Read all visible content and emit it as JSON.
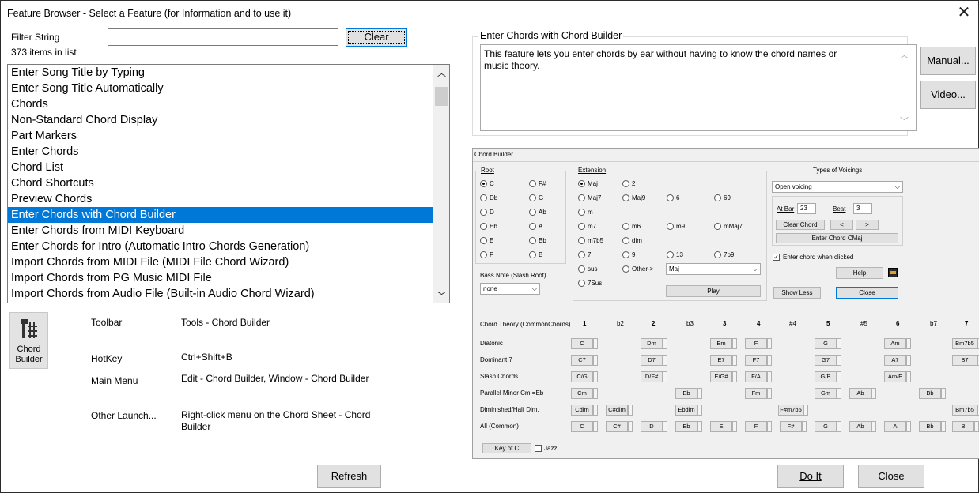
{
  "window": {
    "title": "Feature Browser - Select a Feature (for Information and to use it)"
  },
  "filter": {
    "label": "Filter String",
    "value": "",
    "count_text": "373 items in list",
    "clear_label": "Clear"
  },
  "feature_list": {
    "items": [
      "Enter Song Title by Typing",
      "Enter Song Title Automatically",
      "Chords",
      "Non-Standard Chord Display",
      "Part Markers",
      "Enter Chords",
      "Chord List",
      "Chord Shortcuts",
      "Preview Chords",
      "Enter Chords with Chord Builder",
      "Enter Chords from MIDI Keyboard",
      "Enter Chords for Intro (Automatic Intro Chords Generation)",
      "Import Chords from MIDI File (MIDI File Chord Wizard)",
      "Import Chords from PG Music MIDI File",
      "Import Chords from Audio File (Built-in Audio Chord Wizard)"
    ],
    "selected_index": 9
  },
  "info": {
    "icon_label": "Chord Builder",
    "toolbar_label": "Toolbar",
    "toolbar_value": "Tools - Chord Builder",
    "hotkey_label": "HotKey",
    "hotkey_value": "Ctrl+Shift+B",
    "mainmenu_label": "Main Menu",
    "mainmenu_value": "Edit - Chord Builder,  Window - Chord Builder",
    "other_label": "Other Launch...",
    "other_value_1": "Right-click menu on the Chord Sheet - Chord",
    "other_value_2": "Builder"
  },
  "refresh_label": "Refresh",
  "description": {
    "group_title": "Enter Chords with Chord Builder",
    "text_1": "This feature lets you enter chords by ear without having to know the chord names or",
    "text_2": "music theory."
  },
  "manual_label": "Manual...",
  "video_label": "Video...",
  "doit_label": "Do It",
  "close_label": "Close",
  "chord_builder": {
    "title": "Chord Builder",
    "root_label": "Root",
    "roots": [
      "C",
      "F#",
      "Db",
      "G",
      "D",
      "Ab",
      "Eb",
      "A",
      "E",
      "Bb",
      "F",
      "B"
    ],
    "root_selected": "C",
    "bass_label": "Bass Note (Slash Root)",
    "bass_value": "none",
    "extension_label": "Extension",
    "extensions": [
      [
        "Maj",
        "2",
        "",
        ""
      ],
      [
        "Maj7",
        "Maj9",
        "6",
        "69"
      ],
      [
        "m",
        "",
        "",
        ""
      ],
      [
        "m7",
        "m6",
        "m9",
        "mMaj7"
      ],
      [
        "m7b5",
        "dim",
        "",
        ""
      ],
      [
        "7",
        "9",
        "13",
        "7b9"
      ],
      [
        "sus",
        "Other->",
        "",
        ""
      ],
      [
        "7Sus",
        "",
        "",
        ""
      ]
    ],
    "ext_selected": "Maj",
    "other_value": "Maj",
    "play_label": "Play",
    "voicings_label": "Types of Voicings",
    "voicing_value": "Open voicing",
    "at_bar_label": "At Bar",
    "at_bar_value": "23",
    "beat_label": "Beat",
    "beat_value": "3",
    "clear_chord_label": "Clear Chord",
    "prev_label": "<",
    "next_label": ">",
    "enter_chord_label": "Enter Chord CMaj",
    "enter_when_clicked_label": "Enter chord when clicked",
    "help_label": "Help",
    "show_less_label": "Show Less",
    "close_label": "Close",
    "theory_label": "Chord Theory (CommonChords)",
    "degrees": [
      "1",
      "b2",
      "2",
      "b3",
      "3",
      "4",
      "#4",
      "5",
      "#5",
      "6",
      "b7",
      "7"
    ],
    "rows": [
      {
        "label": "Diatonic",
        "cells": [
          "C",
          "",
          "Dm",
          "",
          "Em",
          "F",
          "",
          "G",
          "",
          "Am",
          "",
          "Bm7b5"
        ]
      },
      {
        "label": "Dominant 7",
        "cells": [
          "C7",
          "",
          "D7",
          "",
          "E7",
          "F7",
          "",
          "G7",
          "",
          "A7",
          "",
          "B7"
        ]
      },
      {
        "label": "Slash Chords",
        "cells": [
          "C/G",
          "",
          "D/F#",
          "",
          "E/G#",
          "F/A",
          "",
          "G/B",
          "",
          "Am/E",
          "",
          ""
        ]
      },
      {
        "label": "Parallel Minor Cm =Eb",
        "cells": [
          "Cm",
          "",
          "",
          "Eb",
          "",
          "Fm",
          "",
          "Gm",
          "Ab",
          "",
          "Bb",
          ""
        ]
      },
      {
        "label": "Diminished/Half Dim.",
        "cells": [
          "Cdim",
          "C#dim",
          "",
          "Ebdim",
          "",
          "",
          "F#m7b5",
          "",
          "",
          "",
          "",
          "Bm7b5"
        ]
      },
      {
        "label": "All (Common)",
        "cells": [
          "C",
          "C#",
          "D",
          "Eb",
          "E",
          "F",
          "F#",
          "G",
          "Ab",
          "A",
          "Bb",
          "B"
        ]
      }
    ],
    "key_label": "Key of C",
    "jazz_label": "Jazz"
  }
}
